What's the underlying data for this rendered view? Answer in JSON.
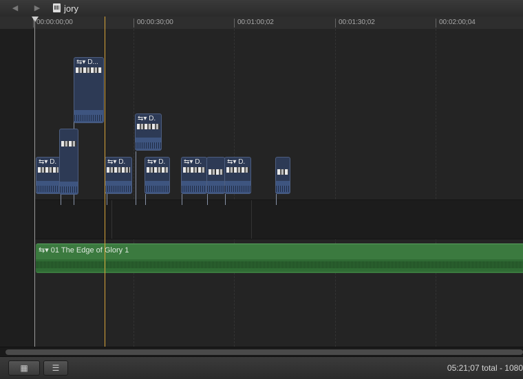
{
  "toolbar": {
    "back_icon": "◀",
    "forward_icon": "▶",
    "project_name": "jory"
  },
  "ruler": {
    "ticks": [
      "00:00:00;00",
      "00:00:30;00",
      "00:01:00;02",
      "00:01:30;02",
      "00:02:00;04"
    ]
  },
  "clips": {
    "label": "D.",
    "label_long": "D..."
  },
  "audio": {
    "name": "01 The Edge of Glory 1"
  },
  "footer": {
    "status": "05:21;07 total - 1080"
  },
  "icons": {
    "back": "chevron-left-icon",
    "forward": "chevron-right-icon",
    "project": "project-icon",
    "clip_appearance": "filmstrip-icon",
    "index": "list-icon"
  },
  "colors": {
    "connected_clip": "#2d3a55",
    "audio_clip": "#3b7a3f",
    "skimmer": "#d9a53a"
  }
}
